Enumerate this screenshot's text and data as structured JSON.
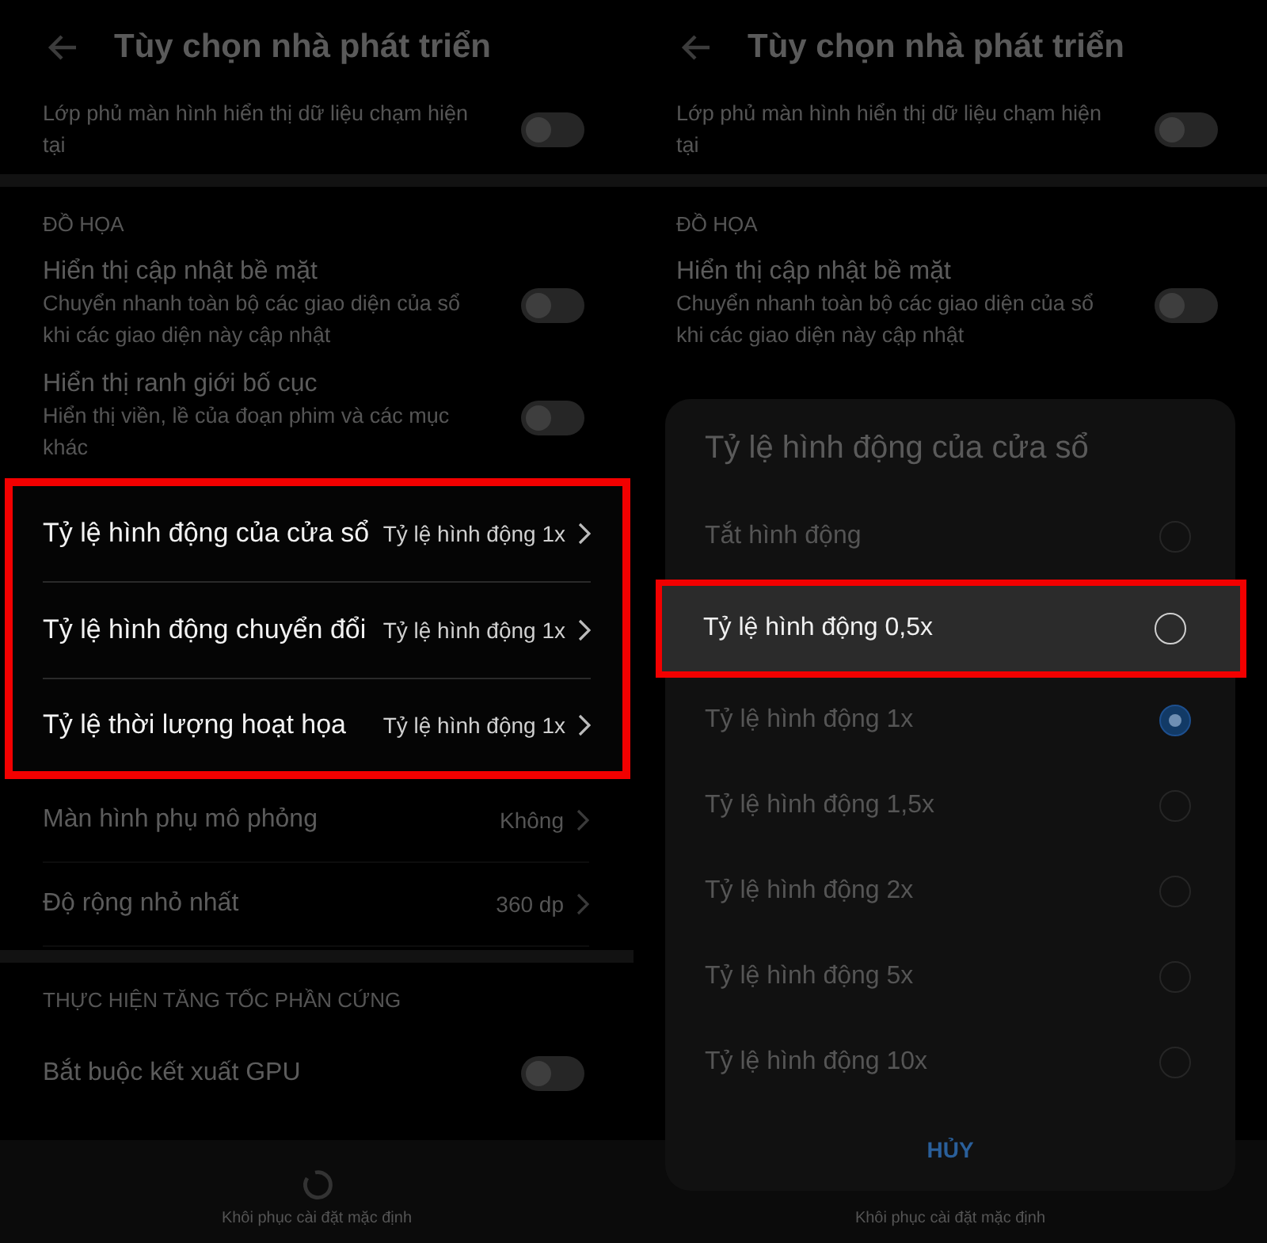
{
  "left": {
    "header": {
      "title": "Tùy chọn nhà phát triển"
    },
    "items": [
      {
        "kind": "toggle",
        "subtitle": "Lớp phủ màn hình hiển thị dữ liệu chạm hiện tại",
        "on": false
      },
      {
        "kind": "band"
      },
      {
        "kind": "section",
        "title": "ĐỒ HỌA"
      },
      {
        "kind": "toggle",
        "title": "Hiển thị cập nhật bề mặt",
        "subtitle": "Chuyển nhanh toàn bộ các giao diện của sổ khi các giao diện này cập nhật",
        "on": false
      },
      {
        "kind": "toggle",
        "title": "Hiển thị ranh giới bố cục",
        "subtitle": "Hiển thị viền, lề của đoạn phim và các mục khác",
        "on": false
      },
      {
        "kind": "group",
        "highlighted": true,
        "rows": [
          {
            "title": "Tỷ lệ hình động của cửa sổ",
            "value": "Tỷ lệ hình động 1x"
          },
          {
            "title": "Tỷ lệ hình động chuyển đổi",
            "value": "Tỷ lệ hình động 1x"
          },
          {
            "title": "Tỷ lệ thời lượng hoạt họa",
            "value": "Tỷ lệ hình động 1x"
          }
        ]
      },
      {
        "kind": "nav",
        "title": "Màn hình phụ mô phỏng",
        "value": "Không"
      },
      {
        "kind": "nav",
        "title": "Độ rộng nhỏ nhất",
        "value": "360 dp"
      },
      {
        "kind": "band"
      },
      {
        "kind": "section",
        "title": "THỰC HIỆN TĂNG TỐC PHẦN CỨNG"
      },
      {
        "kind": "toggle",
        "title": "Bắt buộc kết xuất GPU",
        "on": false
      }
    ],
    "bottom_bar": {
      "label": "Khôi phục cài đặt mặc định"
    }
  },
  "right": {
    "header": {
      "title": "Tùy chọn nhà phát triển"
    },
    "items": [
      {
        "kind": "toggle",
        "subtitle": "Lớp phủ màn hình hiển thị dữ liệu chạm hiện tại",
        "on": false
      },
      {
        "kind": "band"
      },
      {
        "kind": "section",
        "title": "ĐỒ HỌA"
      },
      {
        "kind": "toggle",
        "title": "Hiển thị cập nhật bề mặt",
        "subtitle": "Chuyển nhanh toàn bộ các giao diện của sổ khi các giao diện này cập nhật",
        "on": false
      }
    ],
    "dialog": {
      "title": "Tỷ lệ hình động của cửa sổ",
      "options": [
        {
          "label": "Tắt hình động",
          "selected": false,
          "highlighted": false
        },
        {
          "label": "Tỷ lệ hình động 0,5x",
          "selected": false,
          "highlighted": true
        },
        {
          "label": "Tỷ lệ hình động 1x",
          "selected": true,
          "highlighted": false
        },
        {
          "label": "Tỷ lệ hình động 1,5x",
          "selected": false,
          "highlighted": false
        },
        {
          "label": "Tỷ lệ hình động 2x",
          "selected": false,
          "highlighted": false
        },
        {
          "label": "Tỷ lệ hình động 5x",
          "selected": false,
          "highlighted": false
        },
        {
          "label": "Tỷ lệ hình động 10x",
          "selected": false,
          "highlighted": false
        }
      ],
      "cancel": "HỦY"
    },
    "bottom_bar": {
      "label": "Khôi phục cài đặt mặc định"
    }
  }
}
